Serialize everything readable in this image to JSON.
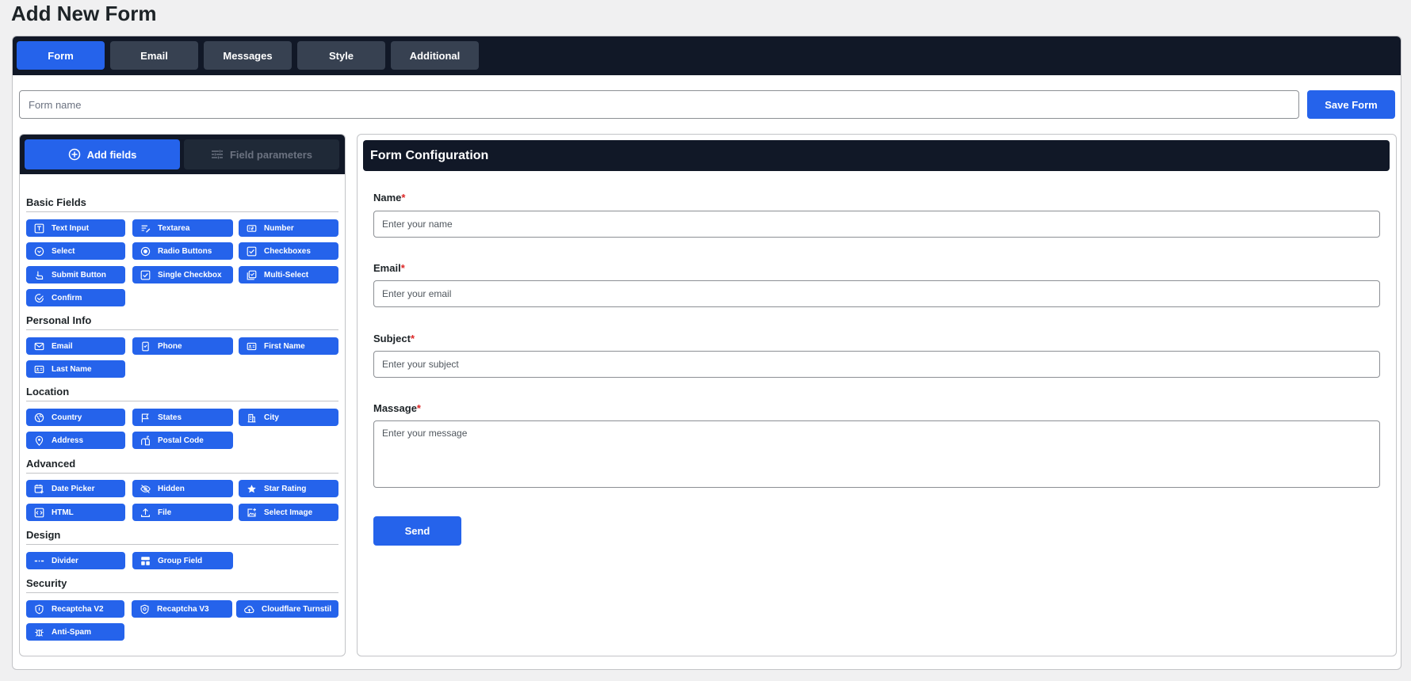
{
  "page": {
    "title": "Add New Form"
  },
  "tabs": [
    {
      "label": "Form",
      "active": true
    },
    {
      "label": "Email",
      "active": false
    },
    {
      "label": "Messages",
      "active": false
    },
    {
      "label": "Style",
      "active": false
    },
    {
      "label": "Additional",
      "active": false
    }
  ],
  "form_name": {
    "placeholder": "Form name",
    "value": ""
  },
  "save_label": "Save Form",
  "panel": {
    "add_fields_label": "Add fields",
    "field_parameters_label": "Field parameters"
  },
  "sections": {
    "basic": {
      "title": "Basic Fields",
      "items": [
        "Text Input",
        "Textarea",
        "Number",
        "Select",
        "Radio Buttons",
        "Checkboxes",
        "Submit Button",
        "Single Checkbox",
        "Multi-Select",
        "Confirm"
      ]
    },
    "personal": {
      "title": "Personal Info",
      "items": [
        "Email",
        "Phone",
        "First Name",
        "Last Name"
      ]
    },
    "location": {
      "title": "Location",
      "items": [
        "Country",
        "States",
        "City",
        "Address",
        "Postal Code"
      ]
    },
    "advanced": {
      "title": "Advanced",
      "items": [
        "Date Picker",
        "Hidden",
        "Star Rating",
        "HTML",
        "File",
        "Select Image"
      ]
    },
    "design": {
      "title": "Design",
      "items": [
        "Divider",
        "Group Field"
      ]
    },
    "security": {
      "title": "Security",
      "items": [
        "Recaptcha V2",
        "Recaptcha V3",
        "Cloudflare Turnstil",
        "Anti-Spam"
      ]
    }
  },
  "config": {
    "title": "Form Configuration",
    "required_mark": "*",
    "fields": [
      {
        "label": "Name",
        "placeholder": "Enter your name"
      },
      {
        "label": "Email",
        "placeholder": "Enter your email"
      },
      {
        "label": "Subject",
        "placeholder": "Enter your subject"
      },
      {
        "label": "Massage",
        "placeholder": "Enter your message"
      }
    ],
    "send_label": "Send"
  },
  "colors": {
    "accent": "#2563eb",
    "dark": "#111827",
    "tab_inactive": "#374151",
    "required": "#dc2626"
  }
}
